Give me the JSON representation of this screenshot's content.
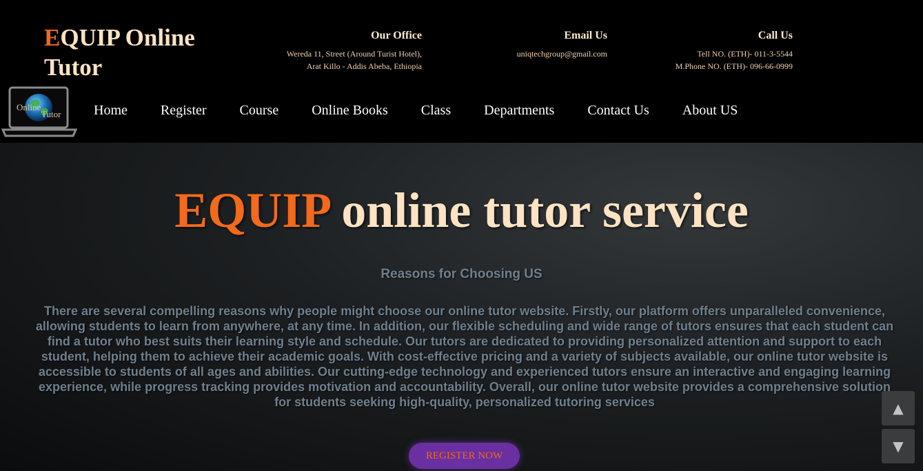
{
  "brand": {
    "accent_letter": "E",
    "rest": "QUIP Online Tutor"
  },
  "logo": {
    "icon": "laptop-globe-icon",
    "line1": "Online",
    "line2": "Tutor"
  },
  "contact": {
    "office": {
      "title": "Our Office",
      "line1": "Wereda 11, Street (Around Turist Hotel),",
      "line2": "Arat Killo - Addis Abeba, Ethiopia"
    },
    "email": {
      "title": "Email Us",
      "line1": "uniqtechgroup@gmail.com"
    },
    "call": {
      "title": "Call Us",
      "line1": "Tell NO. (ETH)- 011-3-5544",
      "line2": "M.Phone NO. (ETH)- 096-66-0999"
    }
  },
  "nav": {
    "items": [
      {
        "label": "Home"
      },
      {
        "label": "Register"
      },
      {
        "label": "Course"
      },
      {
        "label": "Online Books"
      },
      {
        "label": "Class"
      },
      {
        "label": "Departments"
      },
      {
        "label": "Contact Us"
      },
      {
        "label": "About US"
      }
    ]
  },
  "hero": {
    "title_accent": "EQUIP",
    "title_rest": " online tutor service",
    "reasons_title": "Reasons for Choosing US",
    "reasons_text": "There are several compelling reasons why people might choose our online tutor website. Firstly, our platform offers unparalleled convenience, allowing students to learn from anywhere, at any time. In addition, our flexible scheduling and wide range of tutors ensures that each student can find a tutor who best suits their learning style and schedule. Our tutors are dedicated to providing personalized attention and support to each student, helping them to achieve their academic goals. With cost-effective pricing and a variety of subjects available, our online tutor website is accessible to students of all ages and abilities. Our cutting-edge technology and experienced tutors ensure an interactive and engaging learning experience, while progress tracking provides motivation and accountability. Overall, our online tutor website provides a comprehensive solution for students seeking high-quality, personalized tutoring services",
    "register_label": "REGISTER NOW"
  },
  "scroll": {
    "up_glyph": "▲",
    "down_glyph": "▼"
  },
  "colors": {
    "accent": "#f26a1b",
    "cream": "#fde3c3",
    "body_text": "#6e7f8d",
    "button_bg": "#6a2fa0"
  }
}
